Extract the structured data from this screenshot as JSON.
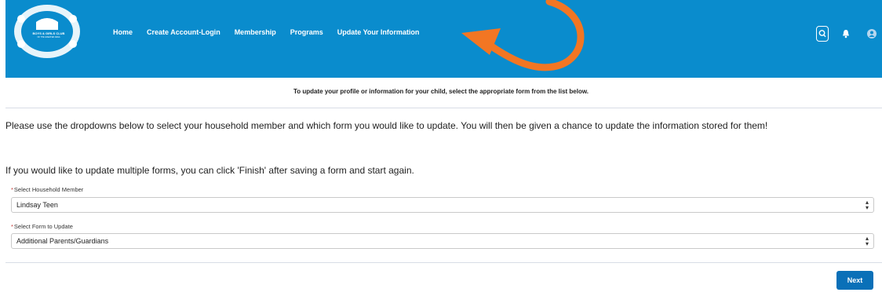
{
  "header": {
    "logo_text": "BOYS & GIRLS CLUB",
    "logo_subtext": "OF THE GREATER AREA",
    "nav": [
      {
        "label": "Home"
      },
      {
        "label": "Create Account-Login"
      },
      {
        "label": "Membership"
      },
      {
        "label": "Programs"
      },
      {
        "label": "Update Your Information"
      }
    ],
    "icons": [
      "search-icon",
      "bell-icon",
      "user-avatar-icon"
    ],
    "bg_color": "#0a8ccd"
  },
  "annotation": {
    "arrow_color": "#f27623"
  },
  "banner": "To update your profile or information for your child, select the appropriate form from the list below.",
  "intro": "Please use the dropdowns below to select your household member and which form you would like to update. You will then be given a chance to update the information stored for them!",
  "note": "If you would like to update multiple forms, you can click 'Finish' after saving a form and start again.",
  "form": {
    "member_label": "Select Household Member",
    "member_value": "Lindsay Teen",
    "form_label": "Select Form to Update",
    "form_value": "Additional Parents/Guardians",
    "required_marker": "*"
  },
  "actions": {
    "next_label": "Next",
    "next_color": "#0a70b8"
  }
}
